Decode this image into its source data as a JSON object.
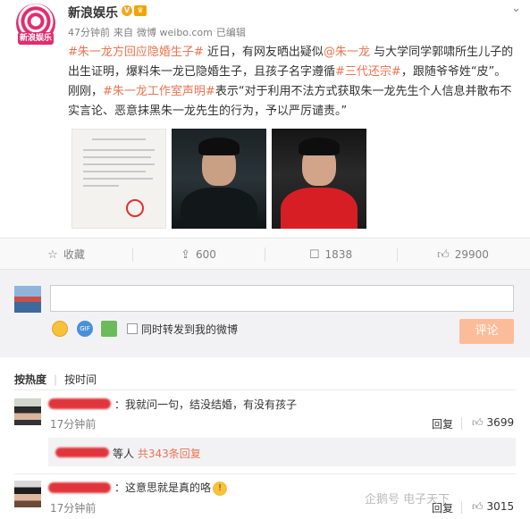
{
  "author": {
    "name": "新浪娱乐",
    "verified_badge": "V",
    "avatar_text": "新浪娱乐"
  },
  "meta": {
    "time": "47分钟前",
    "source_prefix": "来自",
    "source": "微博 weibo.com",
    "edited": "已编辑"
  },
  "more_icon": "chevron-down-icon",
  "post": {
    "tag1": "#朱一龙方回应隐婚生子#",
    "t1": " 近日，有网友晒出疑似",
    "mention": "@朱一龙",
    "t2": " 与大学同学郭啸所生儿子的出生证明，爆料朱一龙已隐婚生子，且孩子名字遵循",
    "tag2": "#三代还宗#",
    "t3": "，跟随爷爷姓“皮”。刚刚，",
    "tag3": "#朱一龙工作室声明#",
    "t4": "表示“对于利用不法方式获取朱一龙先生个人信息并散布不实言论、恶意抹黑朱一龙先生的行为，予以严厉谴责。”"
  },
  "actions": {
    "favorite": "收藏",
    "share_count": "600",
    "comment_count": "1838",
    "like_count": "29900"
  },
  "comment_input": {
    "value": "",
    "forward_label": "同时转发到我的微博",
    "submit": "评论"
  },
  "sort": {
    "hot": "按热度",
    "time": "按时间"
  },
  "comments": [
    {
      "text": "：我就问一句，结没结婚，有没有孩子",
      "time": "17分钟前",
      "reply": "回复",
      "likes": "3699"
    },
    {
      "text": "：这意思就是真的咯",
      "time": "17分钟前",
      "reply": "回复",
      "likes": "3015"
    }
  ],
  "reply_summary": {
    "prefix": "等人 ",
    "link": "共343条回复"
  },
  "watermark": "企鹅号 电子天下",
  "colors": {
    "accent": "#eb7350",
    "submit": "#fdbc99",
    "brand": "#e02d6f"
  }
}
